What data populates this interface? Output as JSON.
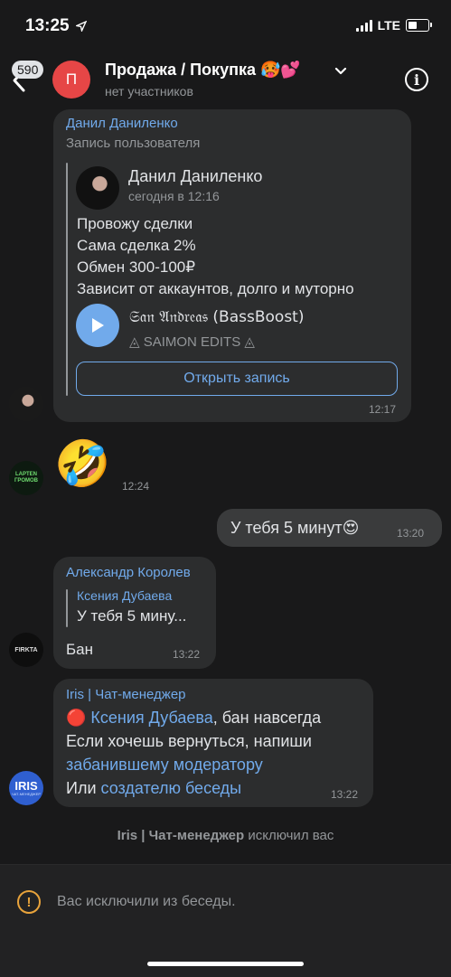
{
  "status": {
    "time": "13:25",
    "carrier": "LTE"
  },
  "header": {
    "back_badge": "590",
    "avatar_letter": "П",
    "title": "Продажа / Покупка 🥵💕",
    "subtitle": "нет участников"
  },
  "messages": {
    "m1": {
      "sender": "Данил Даниленко",
      "label": "Запись пользователя",
      "post_author": "Данил Даниленко",
      "post_date": "сегодня в 12:16",
      "lines": [
        "Провожу сделки",
        "Сама сделка 2%",
        "Обмен 300-100₽",
        "Зависит от аккаунтов, долго и муторно"
      ],
      "audio_title": "𝔖𝔞𝔫 𝔄𝔫𝔡𝔯𝔢𝔞𝔰 (BassBoost)",
      "audio_artist": "◬ SAIMON EDITS ◬",
      "button": "Открыть запись",
      "time": "12:17"
    },
    "m2": {
      "emoji": "🤣",
      "time": "12:24",
      "avatar_text": "LAPTEN\nГРОМОВ"
    },
    "m3": {
      "text": "У тебя 5 минут😍",
      "time": "13:20"
    },
    "m4": {
      "sender": "Александр Королев",
      "reply_name": "Ксения Дубаева",
      "reply_text": "У тебя 5 мину...",
      "text": "Бан",
      "time": "13:22",
      "avatar_text": "FIRKTA"
    },
    "m5": {
      "sender": "Iris | Чат-менеджер",
      "line1_prefix": "🔴 ",
      "line1_link": "Ксения Дубаева",
      "line1_suffix": ", бан навсегда",
      "line2": "Если хочешь вернуться, напиши",
      "line3_link": "забанившему модератору",
      "line4_prefix": "Или ",
      "line4_link": "создателю беседы",
      "time": "13:22",
      "avatar_text": "IRIS",
      "avatar_sub": "ЧАТ-МЕНЕДЖЕР"
    }
  },
  "system": {
    "actor": "Iris | Чат-менеджер",
    "action": " исключил вас"
  },
  "footer": {
    "notice": "Вас исключили из беседы."
  },
  "colors": {
    "accent": "#71aaeb",
    "background": "#19191a",
    "bubble": "#2c2d2e",
    "warning": "#e8a33b"
  }
}
